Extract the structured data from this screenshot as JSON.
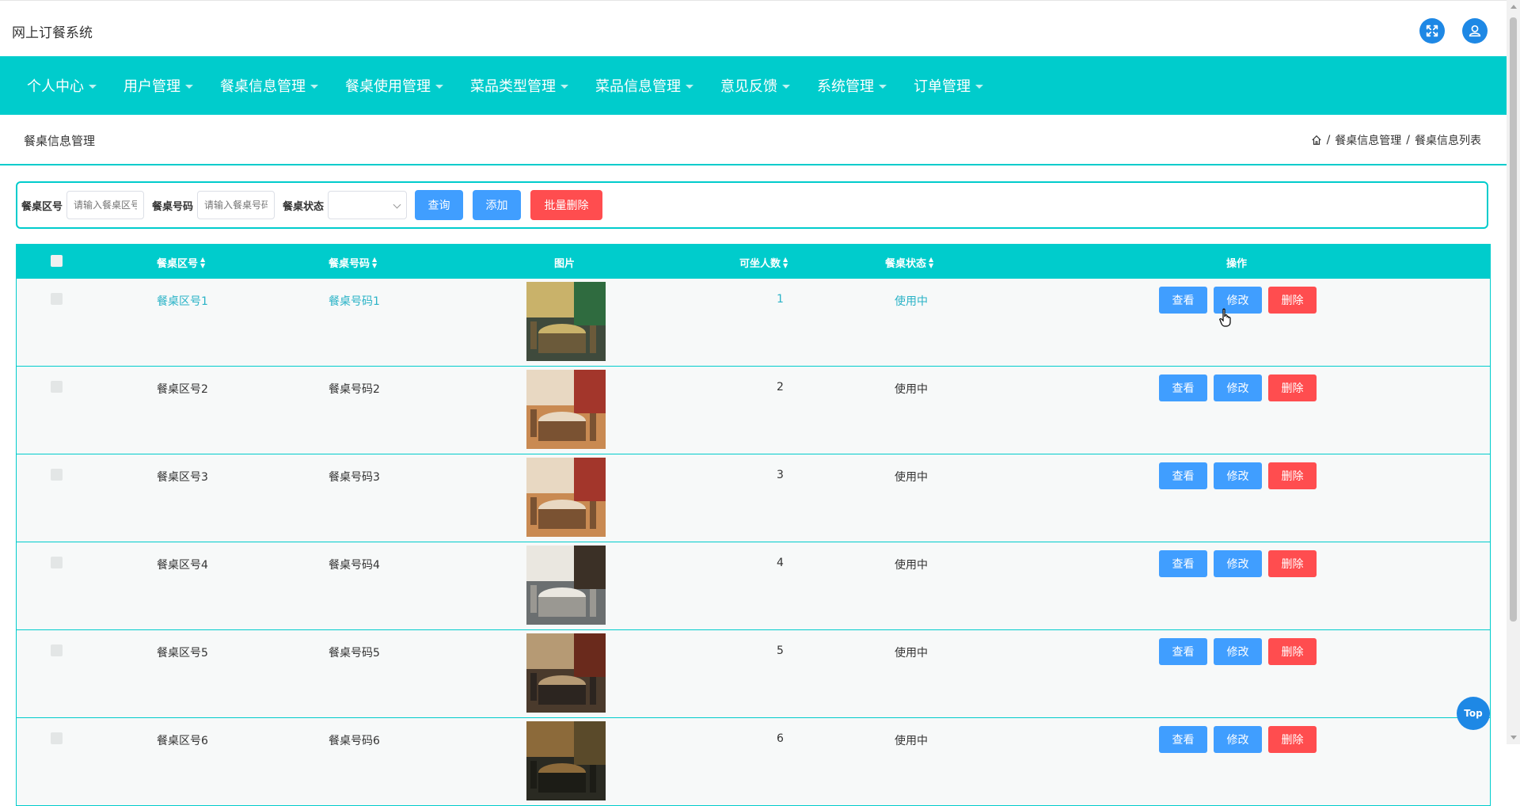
{
  "header": {
    "title": "网上订餐系统",
    "fullscreen_icon": "fullscreen-icon",
    "user_icon": "user-icon"
  },
  "nav": {
    "items": [
      "个人中心",
      "用户管理",
      "餐桌信息管理",
      "餐桌使用管理",
      "菜品类型管理",
      "菜品信息管理",
      "意见反馈",
      "系统管理",
      "订单管理"
    ]
  },
  "page": {
    "title": "餐桌信息管理",
    "breadcrumb": [
      "餐桌信息管理",
      "餐桌信息列表"
    ],
    "separator": "/"
  },
  "search": {
    "area_label": "餐桌区号",
    "area_placeholder": "请输入餐桌区号",
    "number_label": "餐桌号码",
    "number_placeholder": "请输入餐桌号码",
    "status_label": "餐桌状态",
    "status_value": "",
    "query_button": "查询",
    "add_button": "添加",
    "batch_delete_button": "批量删除"
  },
  "table": {
    "headers": {
      "area": "餐桌区号",
      "number": "餐桌号码",
      "image": "图片",
      "seats": "可坐人数",
      "status": "餐桌状态",
      "actions": "操作"
    },
    "sort_icon": "sort-icon",
    "rows": [
      {
        "area": "餐桌区号1",
        "number": "餐桌号码1",
        "seats": "1",
        "status": "使用中",
        "image": "table-photo-1"
      },
      {
        "area": "餐桌区号2",
        "number": "餐桌号码2",
        "seats": "2",
        "status": "使用中",
        "image": "table-photo-2"
      },
      {
        "area": "餐桌区号3",
        "number": "餐桌号码3",
        "seats": "3",
        "status": "使用中",
        "image": "table-photo-3"
      },
      {
        "area": "餐桌区号4",
        "number": "餐桌号码4",
        "seats": "4",
        "status": "使用中",
        "image": "table-photo-4"
      },
      {
        "area": "餐桌区号5",
        "number": "餐桌号码5",
        "seats": "5",
        "status": "使用中",
        "image": "table-photo-5"
      },
      {
        "area": "餐桌区号6",
        "number": "餐桌号码6",
        "seats": "6",
        "status": "使用中",
        "image": "table-photo-6"
      }
    ],
    "actions": {
      "view": "查看",
      "edit": "修改",
      "delete": "删除"
    }
  },
  "back_to_top": "Top",
  "colors": {
    "primary": "#00cccc",
    "button_blue": "#409eff",
    "button_red": "#ff4d4f",
    "icon_blue": "#1e88e5",
    "active_text": "#2ab3c7"
  }
}
